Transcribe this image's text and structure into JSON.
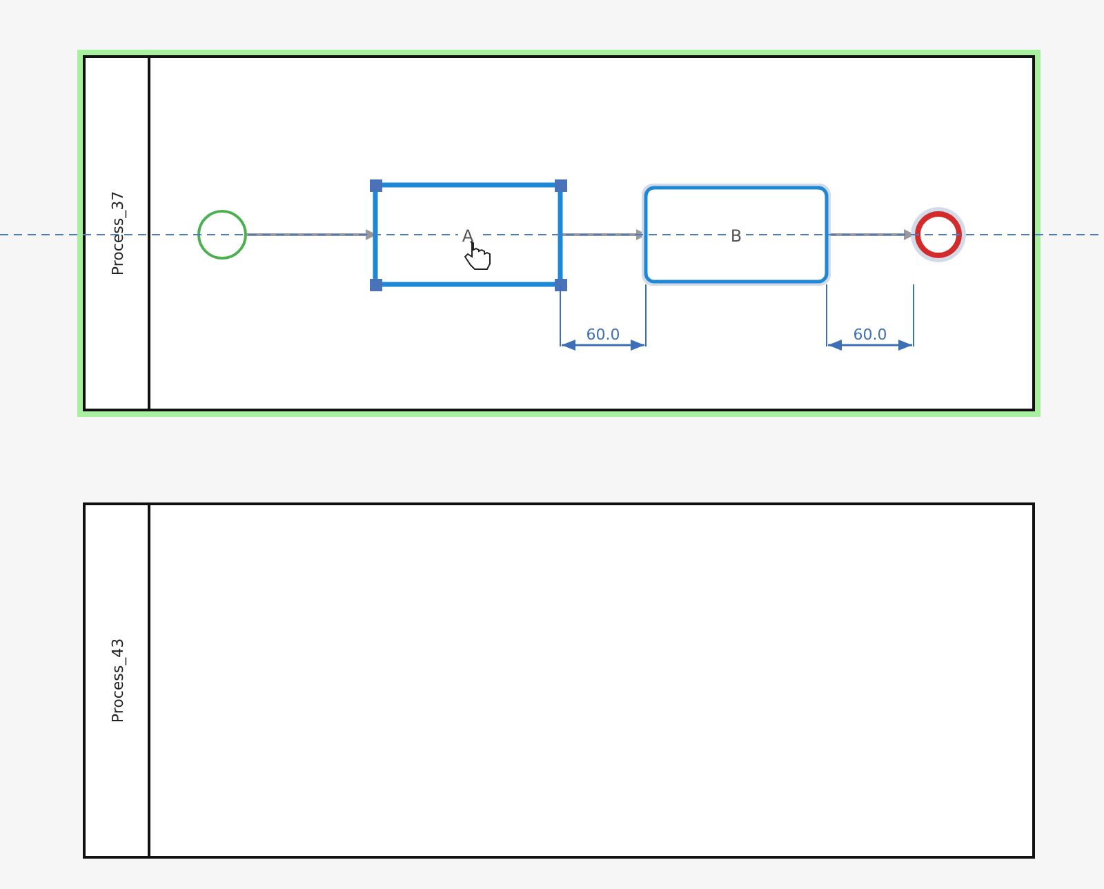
{
  "pools": [
    {
      "name": "Process_37",
      "selected": true,
      "nodes": [
        {
          "kind": "start"
        },
        {
          "kind": "task",
          "label": "A",
          "selected": true,
          "hovered": false
        },
        {
          "kind": "task",
          "label": "B",
          "selected": false,
          "hovered": true
        },
        {
          "kind": "end",
          "hovered": true
        }
      ],
      "spacings": [
        {
          "label": "60.0"
        },
        {
          "label": "60.0"
        }
      ]
    },
    {
      "name": "Process_43",
      "selected": false
    }
  ]
}
